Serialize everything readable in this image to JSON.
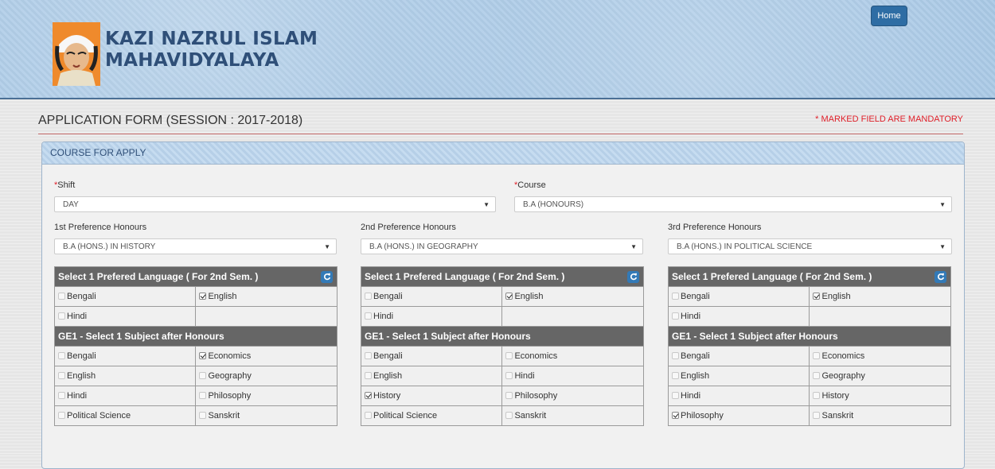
{
  "header": {
    "logo_line1": "KAZI NAZRUL ISLAM",
    "logo_line2": "MAHAVIDYALAYA",
    "home_label": "Home"
  },
  "page": {
    "title": "APPLICATION FORM (SESSION : 2017-2018)",
    "mandatory_note": "* MARKED FIELD ARE MANDATORY"
  },
  "panel": {
    "heading": "COURSE FOR APPLY",
    "shift": {
      "label": "Shift",
      "value": "DAY"
    },
    "course": {
      "label": "Course",
      "value": "B.A (HONOURS)"
    },
    "preferences": [
      {
        "label": "1st Preference Honours",
        "value": "B.A (HONS.) IN HISTORY",
        "language_title": "Select 1 Prefered Language ( For 2nd Sem. )",
        "languages": [
          {
            "name": "Bengali",
            "checked": false
          },
          {
            "name": "English",
            "checked": true
          },
          {
            "name": "Hindi",
            "checked": false
          }
        ],
        "ge_title": "GE1 - Select 1 Subject after Honours",
        "subjects": [
          {
            "name": "Bengali",
            "checked": false
          },
          {
            "name": "Economics",
            "checked": true
          },
          {
            "name": "English",
            "checked": false
          },
          {
            "name": "Geography",
            "checked": false
          },
          {
            "name": "Hindi",
            "checked": false
          },
          {
            "name": "Philosophy",
            "checked": false
          },
          {
            "name": "Political Science",
            "checked": false
          },
          {
            "name": "Sanskrit",
            "checked": false
          }
        ]
      },
      {
        "label": "2nd Preference Honours",
        "value": "B.A (HONS.) IN GEOGRAPHY",
        "language_title": "Select 1 Prefered Language ( For 2nd Sem. )",
        "languages": [
          {
            "name": "Bengali",
            "checked": false
          },
          {
            "name": "English",
            "checked": true
          },
          {
            "name": "Hindi",
            "checked": false
          }
        ],
        "ge_title": "GE1 - Select 1 Subject after Honours",
        "subjects": [
          {
            "name": "Bengali",
            "checked": false
          },
          {
            "name": "Economics",
            "checked": false
          },
          {
            "name": "English",
            "checked": false
          },
          {
            "name": "Hindi",
            "checked": false
          },
          {
            "name": "History",
            "checked": true
          },
          {
            "name": "Philosophy",
            "checked": false
          },
          {
            "name": "Political Science",
            "checked": false
          },
          {
            "name": "Sanskrit",
            "checked": false
          }
        ]
      },
      {
        "label": "3rd Preference Honours",
        "value": "B.A (HONS.) IN POLITICAL SCIENCE",
        "language_title": "Select 1 Prefered Language ( For 2nd Sem. )",
        "languages": [
          {
            "name": "Bengali",
            "checked": false
          },
          {
            "name": "English",
            "checked": true
          },
          {
            "name": "Hindi",
            "checked": false
          }
        ],
        "ge_title": "GE1 - Select 1 Subject after Honours",
        "subjects": [
          {
            "name": "Bengali",
            "checked": false
          },
          {
            "name": "Economics",
            "checked": false
          },
          {
            "name": "English",
            "checked": false
          },
          {
            "name": "Geography",
            "checked": false
          },
          {
            "name": "Hindi",
            "checked": false
          },
          {
            "name": "History",
            "checked": false
          },
          {
            "name": "Philosophy",
            "checked": true
          },
          {
            "name": "Sanskrit",
            "checked": false
          }
        ]
      }
    ]
  },
  "icons": {
    "refresh": "refresh-icon",
    "dropdown": "caret-down-icon",
    "logo": "poet-portrait-logo"
  }
}
